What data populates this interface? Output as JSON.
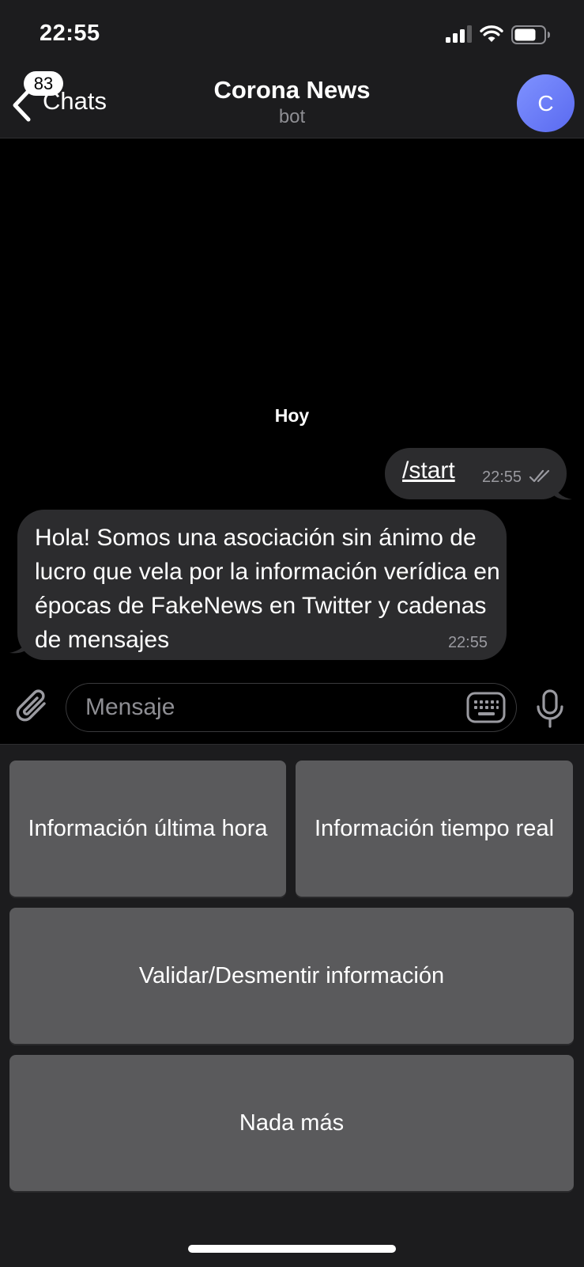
{
  "status_bar": {
    "time": "22:55",
    "icons": [
      "signal-icon",
      "wifi-icon",
      "battery-icon"
    ]
  },
  "header": {
    "back_label": "Chats",
    "unread_badge": "83",
    "title": "Corona News",
    "subtitle": "bot",
    "avatar_letter": "C",
    "avatar_color": "#6b7df5"
  },
  "chat": {
    "date_separator": "Hoy",
    "messages": [
      {
        "direction": "outgoing",
        "text": "/start",
        "time": "22:55",
        "status": "read"
      },
      {
        "direction": "incoming",
        "text": "Hola! Somos una asociación sin ánimo de lucro que vela por la información verídica en épocas de FakeNews en Twitter y cadenas de mensajes",
        "time": "22:55"
      }
    ]
  },
  "input_bar": {
    "placeholder": "Mensaje",
    "value": ""
  },
  "bot_keyboard": {
    "buttons": [
      "Información última hora",
      "Información tiempo real",
      "Validar/Desmentir información",
      "Nada más"
    ]
  },
  "colors": {
    "background": "#000000",
    "bar": "#1c1c1e",
    "bubble": "#2c2c2e",
    "keyboard_button": "#5a5a5c"
  }
}
